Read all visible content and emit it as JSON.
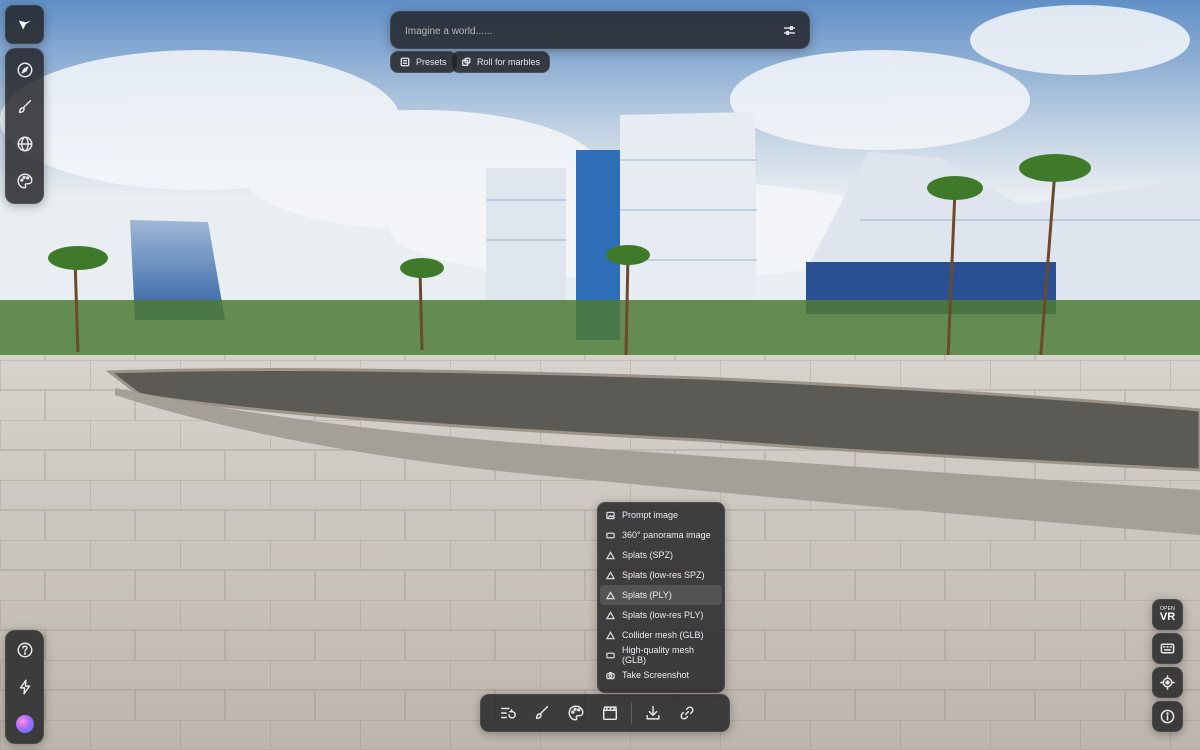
{
  "prompt": {
    "placeholder": "Imagine a world......"
  },
  "chips": [
    {
      "label": "Presets",
      "icon": "presets-icon"
    },
    {
      "label": "Roll for marbles",
      "icon": "dice-icon"
    }
  ],
  "left_tools": [
    "compass-icon",
    "brush-icon",
    "globe-icon",
    "palette-icon"
  ],
  "left_bottom": [
    "help-icon",
    "lightning-icon",
    "avatar"
  ],
  "right_tools": {
    "vr_small": "OPEN",
    "vr_big": "VR",
    "others": [
      "keyboard-icon",
      "recenter-icon",
      "info-icon"
    ]
  },
  "download_menu": {
    "items": [
      {
        "label": "Prompt image",
        "icon": "image-icon"
      },
      {
        "label": "360° panorama image",
        "icon": "panorama-icon"
      },
      {
        "label": "Splats (SPZ)",
        "icon": "triangle-icon"
      },
      {
        "label": "Splats (low-res SPZ)",
        "icon": "triangle-icon"
      },
      {
        "label": "Splats (PLY)",
        "icon": "triangle-icon",
        "highlighted": true
      },
      {
        "label": "Splats (low-res PLY)",
        "icon": "triangle-icon"
      },
      {
        "label": "Collider mesh (GLB)",
        "icon": "triangle-icon"
      },
      {
        "label": "High-quality mesh (GLB)",
        "icon": "panorama-icon"
      },
      {
        "label": "Take Screenshot",
        "icon": "camera-icon"
      }
    ]
  },
  "bottom_toolbar": [
    "history-icon",
    "brush-icon",
    "palette-icon",
    "clapper-icon",
    "download-icon",
    "link-icon"
  ],
  "colors": {
    "panel": "#202022",
    "sky": "#7aa4d6",
    "ground": "#cfcac2"
  }
}
